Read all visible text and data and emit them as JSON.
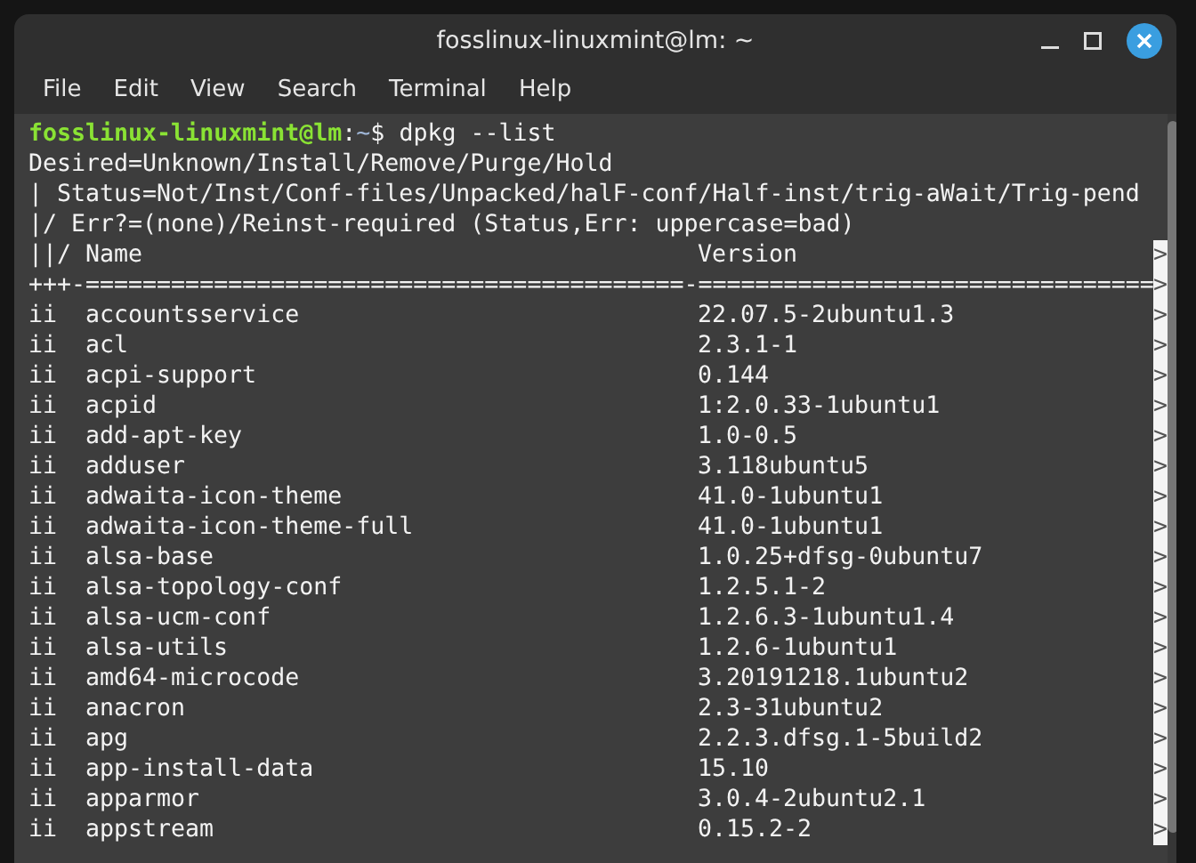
{
  "window": {
    "title": "fosslinux-linuxmint@lm: ~"
  },
  "menu": [
    "File",
    "Edit",
    "View",
    "Search",
    "Terminal",
    "Help"
  ],
  "prompt": {
    "user_host": "fosslinux-linuxmint@lm",
    "separator": ":",
    "path": "~",
    "symbol": "$",
    "command": "dpkg --list"
  },
  "legend": [
    "Desired=Unknown/Install/Remove/Purge/Hold",
    "| Status=Not/Inst/Conf-files/Unpacked/halF-conf/Half-inst/trig-aWait/Trig-pend",
    "|/ Err?=(none)/Reinst-required (Status,Err: uppercase=bad)"
  ],
  "header": {
    "status": "||/",
    "name": "Name",
    "version": "Version",
    "mark": ">"
  },
  "separator": {
    "text": "+++-==========================================-================================",
    "mark": ">"
  },
  "packages": [
    {
      "status": "ii",
      "name": "accountsservice",
      "version": "22.07.5-2ubuntu1.3",
      "mark": ">"
    },
    {
      "status": "ii",
      "name": "acl",
      "version": "2.3.1-1",
      "mark": ">"
    },
    {
      "status": "ii",
      "name": "acpi-support",
      "version": "0.144",
      "mark": ">"
    },
    {
      "status": "ii",
      "name": "acpid",
      "version": "1:2.0.33-1ubuntu1",
      "mark": ">"
    },
    {
      "status": "ii",
      "name": "add-apt-key",
      "version": "1.0-0.5",
      "mark": ">"
    },
    {
      "status": "ii",
      "name": "adduser",
      "version": "3.118ubuntu5",
      "mark": ">"
    },
    {
      "status": "ii",
      "name": "adwaita-icon-theme",
      "version": "41.0-1ubuntu1",
      "mark": ">"
    },
    {
      "status": "ii",
      "name": "adwaita-icon-theme-full",
      "version": "41.0-1ubuntu1",
      "mark": ">"
    },
    {
      "status": "ii",
      "name": "alsa-base",
      "version": "1.0.25+dfsg-0ubuntu7",
      "mark": ">"
    },
    {
      "status": "ii",
      "name": "alsa-topology-conf",
      "version": "1.2.5.1-2",
      "mark": ">"
    },
    {
      "status": "ii",
      "name": "alsa-ucm-conf",
      "version": "1.2.6.3-1ubuntu1.4",
      "mark": ">"
    },
    {
      "status": "ii",
      "name": "alsa-utils",
      "version": "1.2.6-1ubuntu1",
      "mark": ">"
    },
    {
      "status": "ii",
      "name": "amd64-microcode",
      "version": "3.20191218.1ubuntu2",
      "mark": ">"
    },
    {
      "status": "ii",
      "name": "anacron",
      "version": "2.3-31ubuntu2",
      "mark": ">"
    },
    {
      "status": "ii",
      "name": "apg",
      "version": "2.2.3.dfsg.1-5build2",
      "mark": ">"
    },
    {
      "status": "ii",
      "name": "app-install-data",
      "version": "15.10",
      "mark": ">"
    },
    {
      "status": "ii",
      "name": "apparmor",
      "version": "3.0.4-2ubuntu2.1",
      "mark": ">"
    },
    {
      "status": "ii",
      "name": "appstream",
      "version": "0.15.2-2",
      "mark": ">"
    }
  ]
}
